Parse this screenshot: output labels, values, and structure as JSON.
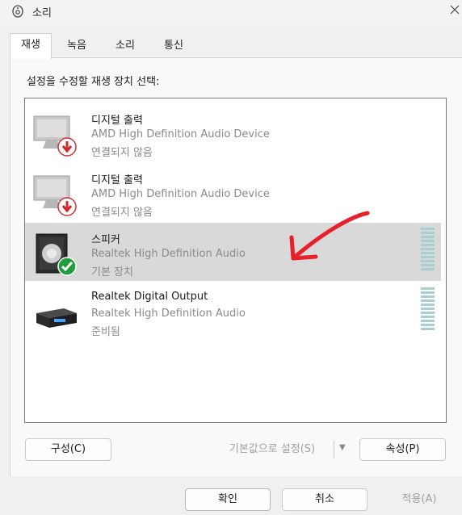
{
  "window": {
    "title": "소리",
    "close_label": "×"
  },
  "tabs": [
    {
      "label": "재생",
      "active": true
    },
    {
      "label": "녹음",
      "active": false
    },
    {
      "label": "소리",
      "active": false
    },
    {
      "label": "통신",
      "active": false
    }
  ],
  "instruction": "설정을 수정할 재생 장치 선택:",
  "devices": [
    {
      "name": "디지털 출력",
      "description": "AMD High Definition Audio Device",
      "status": "연결되지 않음",
      "icon": "monitor-icon",
      "badge": "disconnected-badge",
      "selected": false,
      "enabled": false
    },
    {
      "name": "디지털 출력",
      "description": "AMD High Definition Audio Device",
      "status": "연결되지 않음",
      "icon": "monitor-icon",
      "badge": "disconnected-badge",
      "selected": false,
      "enabled": false
    },
    {
      "name": "스피커",
      "description": "Realtek High Definition Audio",
      "status": "기본 장치",
      "icon": "speaker-icon",
      "badge": "default-check-badge",
      "selected": true,
      "enabled": true
    },
    {
      "name": "Realtek Digital Output",
      "description": "Realtek High Definition Audio",
      "status": "준비됨",
      "icon": "digital-output-icon",
      "badge": "",
      "selected": false,
      "enabled": true
    }
  ],
  "buttons": {
    "configure": "구성(C)",
    "set_default": "기본값으로 설정(S)",
    "properties": "속성(P)",
    "ok": "확인",
    "cancel": "취소",
    "apply": "적용(A)"
  },
  "colors": {
    "annotation_arrow": "#e8202a",
    "check_badge": "#1e9e3a",
    "down_badge": "#d32626",
    "meter": "#a9cfd2"
  }
}
